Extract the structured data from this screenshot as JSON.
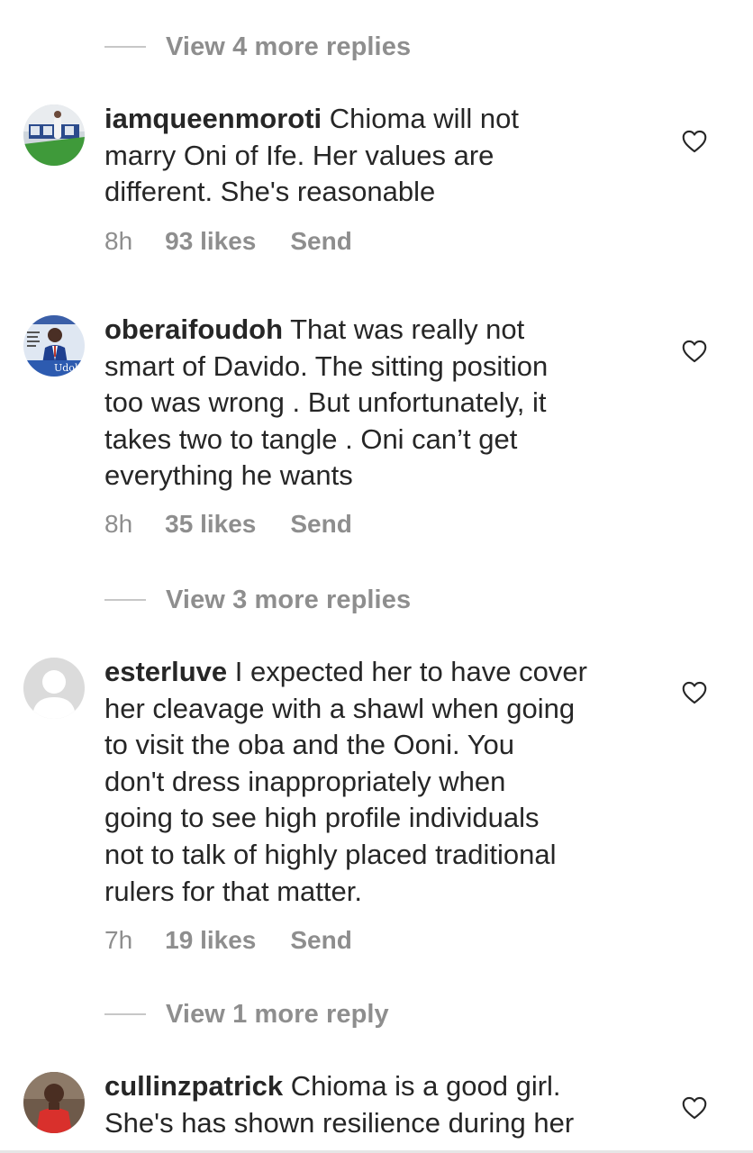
{
  "view_replies": [
    {
      "label": "View 4 more replies"
    },
    {
      "label": "View 3 more replies"
    },
    {
      "label": "View 1 more reply"
    }
  ],
  "comments": [
    {
      "username": "iamqueenmoroti",
      "text": "Chioma will not\nmarry Oni of Ife. Her values are\ndifferent. She's reasonable",
      "time": "8h",
      "likes": "93 likes",
      "send": "Send"
    },
    {
      "username": "oberaifoudoh",
      "text": "That was really not\nsmart of Davido. The sitting position\ntoo was wrong . But unfortunately, it\ntakes two to tangle . Oni can’t get\neverything he wants",
      "time": "8h",
      "likes": "35 likes",
      "send": "Send"
    },
    {
      "username": "esterluve",
      "text": "I expected her to have cover\nher cleavage with a shawl when going\nto visit the oba and the Ooni. You\ndon't dress inappropriately when\ngoing to see high profile individuals\nnot to talk of highly placed traditional\nrulers for that matter.",
      "time": "7h",
      "likes": "19 likes",
      "send": "Send"
    },
    {
      "username": "cullinzpatrick",
      "text": "Chioma is a good girl.\nShe's has shown resilience during her",
      "time": "",
      "likes": "",
      "send": ""
    }
  ],
  "avatar_2_caption": "Udoh",
  "colors": {
    "text": "#262626",
    "secondary": "#8e8e8e",
    "divider": "#c7c7c7",
    "background": "#ffffff"
  },
  "icons": {
    "like": "heart-outline-icon"
  }
}
